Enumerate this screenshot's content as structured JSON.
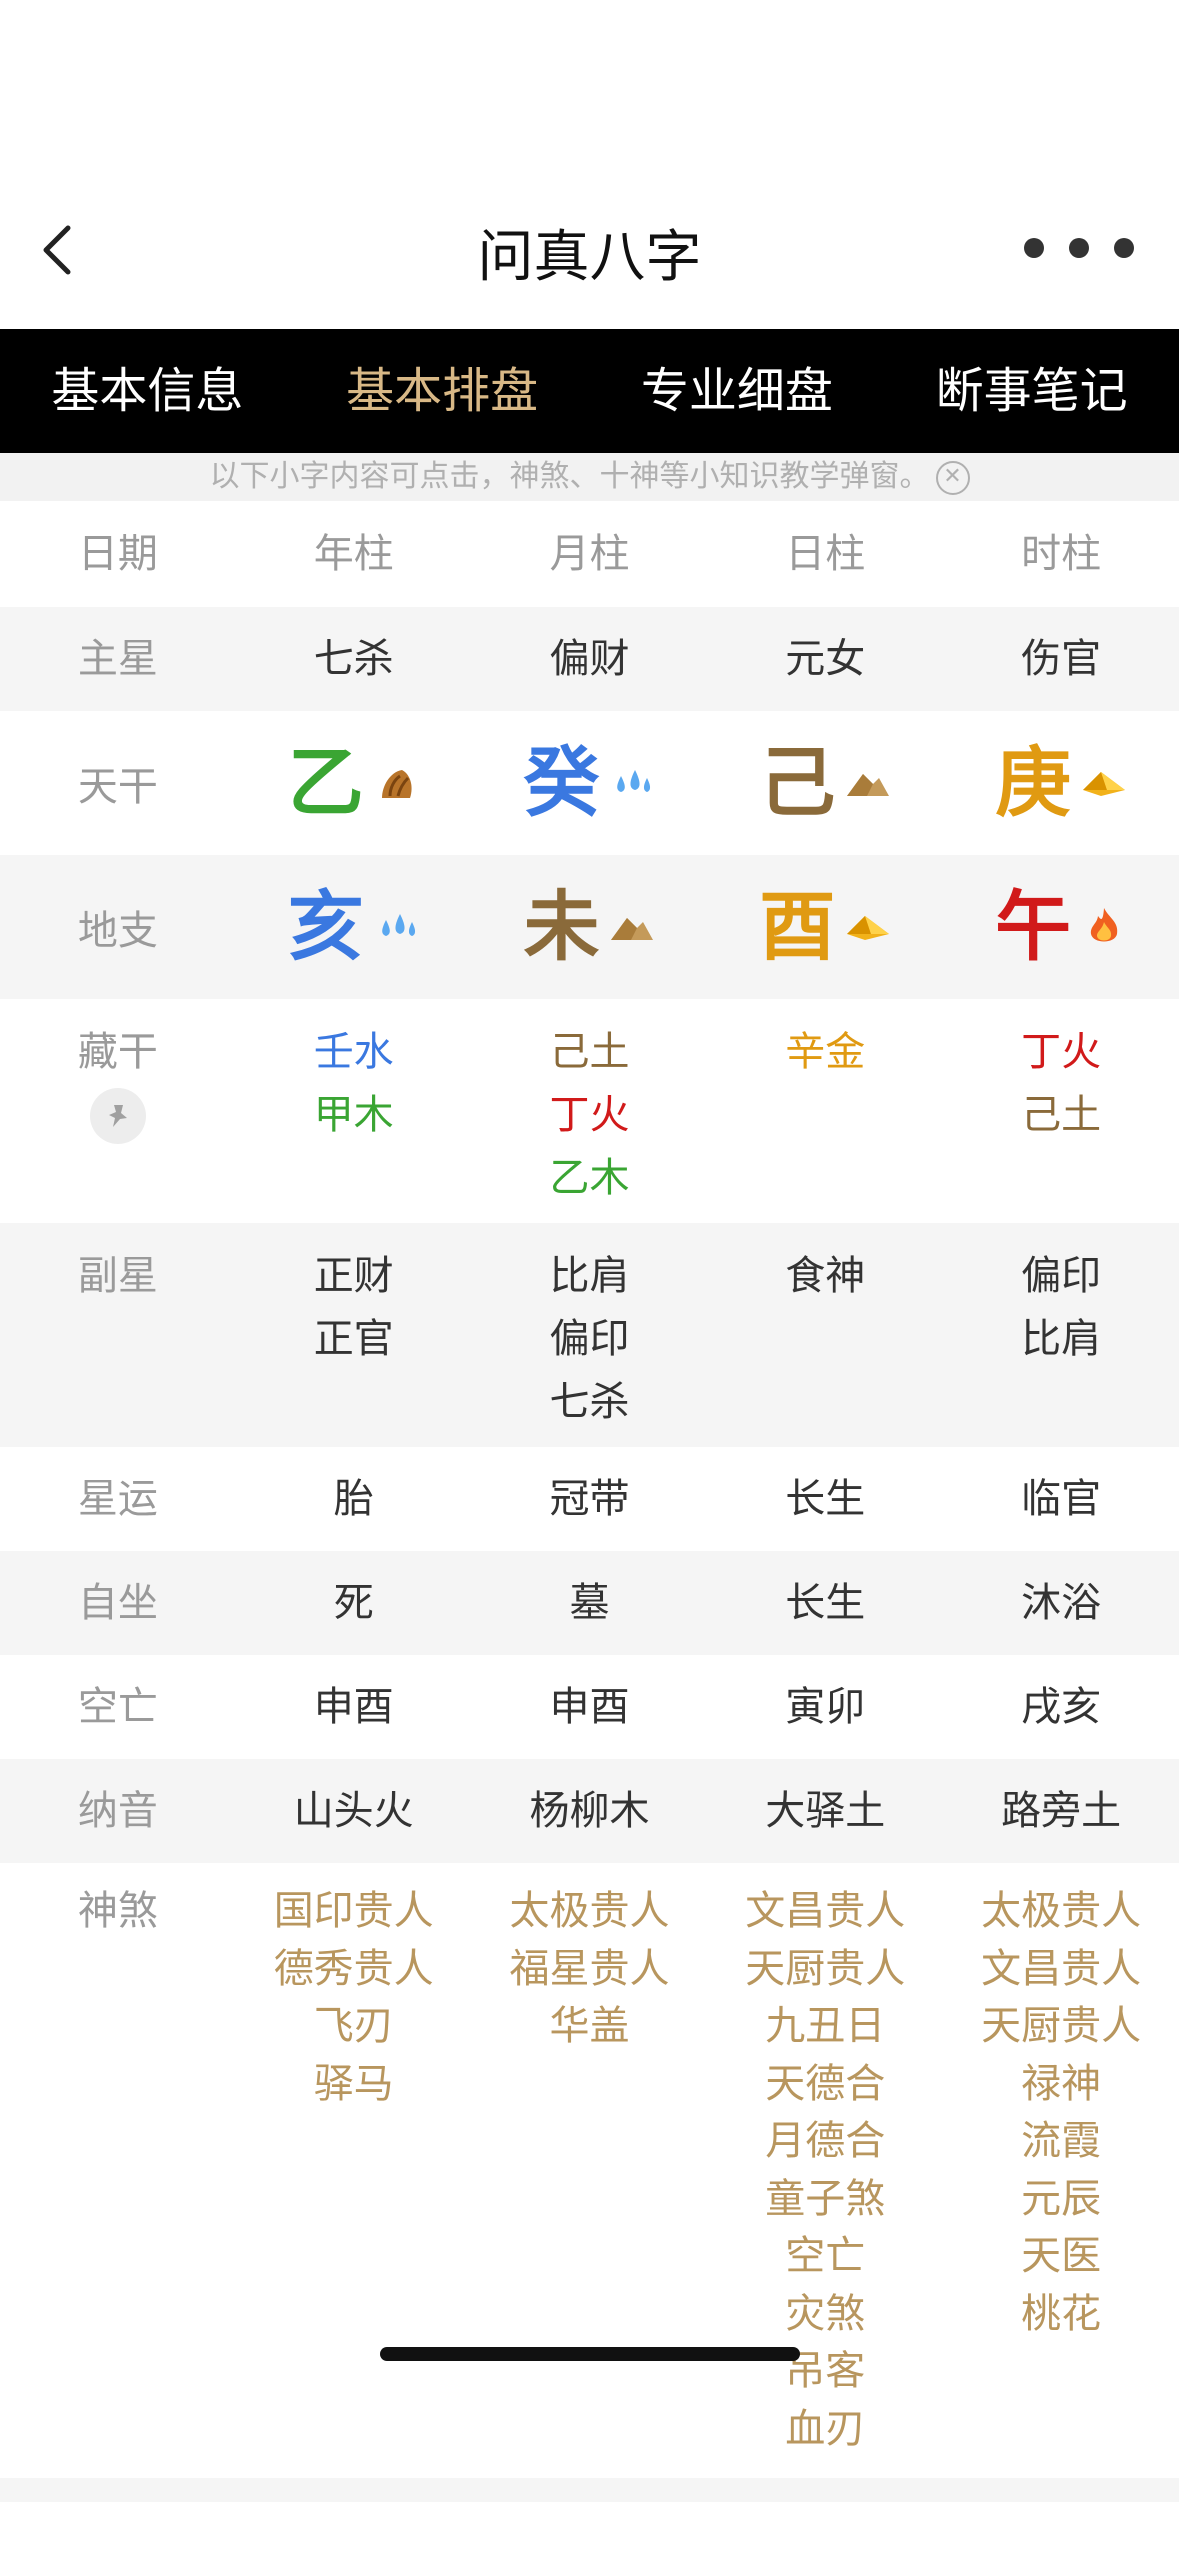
{
  "nav": {
    "title": "问真八字"
  },
  "tabs": [
    {
      "label": "基本信息",
      "active": false
    },
    {
      "label": "基本排盘",
      "active": true
    },
    {
      "label": "专业细盘",
      "active": false
    },
    {
      "label": "断事笔记",
      "active": false
    }
  ],
  "hint": {
    "text": "以下小字内容可点击，神煞、十神等小知识教学弹窗。"
  },
  "grid": {
    "header": [
      "日期",
      "年柱",
      "月柱",
      "日柱",
      "时柱"
    ],
    "main_star": {
      "label": "主星",
      "values": [
        "七杀",
        "偏财",
        "元女",
        "伤官"
      ]
    },
    "tiangan": {
      "label": "天干",
      "items": [
        {
          "char": "乙",
          "color": "#3aa533",
          "icon": "wood-icon"
        },
        {
          "char": "癸",
          "color": "#3a78e0",
          "icon": "water-icon"
        },
        {
          "char": "己",
          "color": "#8a6a3a",
          "icon": "earth-icon"
        },
        {
          "char": "庚",
          "color": "#e09a12",
          "icon": "metal-icon"
        }
      ]
    },
    "dizhi": {
      "label": "地支",
      "items": [
        {
          "char": "亥",
          "color": "#3a78e0",
          "icon": "water-icon"
        },
        {
          "char": "未",
          "color": "#8a6a3a",
          "icon": "earth-icon"
        },
        {
          "char": "酉",
          "color": "#e09a12",
          "icon": "metal-icon"
        },
        {
          "char": "午",
          "color": "#d11a1a",
          "icon": "fire-icon"
        }
      ]
    },
    "canggan": {
      "label": "藏干",
      "cols": [
        [
          {
            "t": "壬水",
            "c": "#3a78e0"
          },
          {
            "t": "甲木",
            "c": "#3aa533"
          }
        ],
        [
          {
            "t": "己土",
            "c": "#8a6a3a"
          },
          {
            "t": "丁火",
            "c": "#d11a1a"
          },
          {
            "t": "乙木",
            "c": "#3aa533"
          }
        ],
        [
          {
            "t": "辛金",
            "c": "#e09a12"
          }
        ],
        [
          {
            "t": "丁火",
            "c": "#d11a1a"
          },
          {
            "t": "己土",
            "c": "#8a6a3a"
          }
        ]
      ]
    },
    "fuxing": {
      "label": "副星",
      "cols": [
        [
          "正财",
          "正官"
        ],
        [
          "比肩",
          "偏印",
          "七杀"
        ],
        [
          "食神"
        ],
        [
          "偏印",
          "比肩"
        ]
      ]
    },
    "xingyun": {
      "label": "星运",
      "values": [
        "胎",
        "冠带",
        "长生",
        "临官"
      ]
    },
    "zizuo": {
      "label": "自坐",
      "values": [
        "死",
        "墓",
        "长生",
        "沐浴"
      ]
    },
    "kongwang": {
      "label": "空亡",
      "values": [
        "申酉",
        "申酉",
        "寅卯",
        "戌亥"
      ]
    },
    "nayin": {
      "label": "纳音",
      "values": [
        "山头火",
        "杨柳木",
        "大驿土",
        "路旁土"
      ]
    },
    "shensha": {
      "label": "神煞",
      "cols": [
        [
          "国印贵人",
          "德秀贵人",
          "飞刃",
          "驿马"
        ],
        [
          "太极贵人",
          "福星贵人",
          "华盖"
        ],
        [
          "文昌贵人",
          "天厨贵人",
          "九丑日",
          "天德合",
          "月德合",
          "童子煞",
          "空亡",
          "灾煞",
          "吊客",
          "血刃"
        ],
        [
          "太极贵人",
          "文昌贵人",
          "天厨贵人",
          "禄神",
          "流霞",
          "元辰",
          "天医",
          "桃花"
        ]
      ]
    }
  }
}
